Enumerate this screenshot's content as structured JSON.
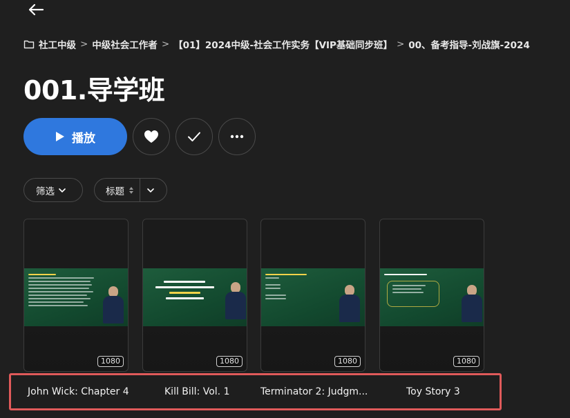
{
  "nav": {
    "back_icon": "arrow-left-icon"
  },
  "breadcrumb": {
    "folder_icon": "folder-icon",
    "items": [
      "社工中级",
      "中级社会工作者",
      "【01】2024中级-社会工作实务【VIP基础同步班】",
      "00、备考指导-刘战旗-2024"
    ],
    "separator": ">"
  },
  "page": {
    "title": "001.导学班"
  },
  "actions": {
    "play_label": "播放",
    "play_icon": "play-icon",
    "favorite_icon": "heart-icon",
    "watched_icon": "check-icon",
    "more_icon": "more-horizontal-icon",
    "accent_color": "#2f78de"
  },
  "filters": {
    "filter_label": "筛选",
    "sort_label": "标题"
  },
  "videos": [
    {
      "resolution": "1080",
      "thumbnail": "slide-text-with-lecturer"
    },
    {
      "resolution": "1080",
      "thumbnail": "title-slide-with-lecturer"
    },
    {
      "resolution": "1080",
      "thumbnail": "section-slide-with-lecturer"
    },
    {
      "resolution": "1080",
      "thumbnail": "outline-slide-with-lecturer"
    }
  ],
  "movie_strip": {
    "highlight_color": "#e05a5a",
    "titles": [
      "John Wick: Chapter 4",
      "Kill Bill: Vol. 1",
      "Terminator 2: Judgm...",
      "Toy Story 3"
    ]
  }
}
